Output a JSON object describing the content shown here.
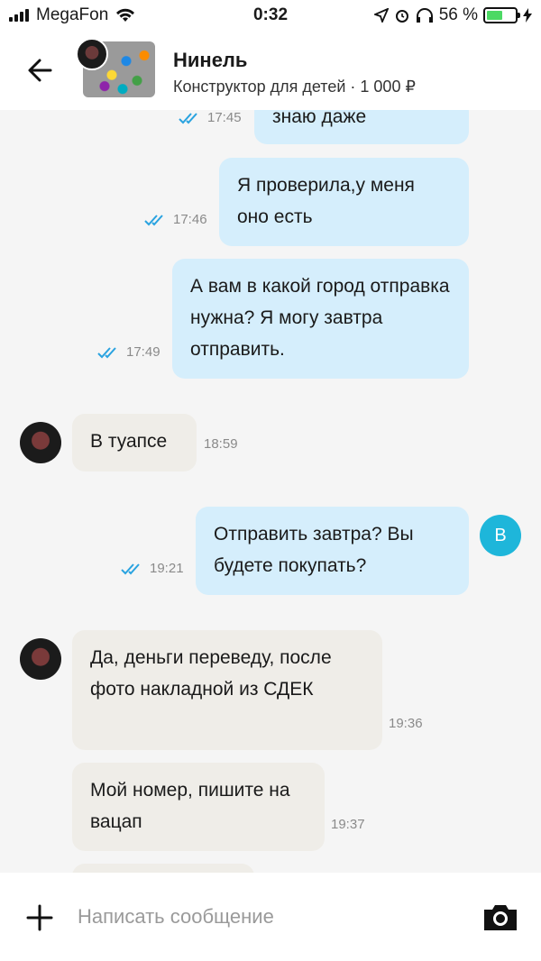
{
  "status_bar": {
    "carrier": "MegaFon",
    "time": "0:32",
    "battery": "56 %",
    "battery_level": 0.56
  },
  "header": {
    "name": "Нинель",
    "subtitle": "Конструктор для детей · 1 000 ₽"
  },
  "messages": [
    {
      "text": "знаю даже",
      "time": "17:45",
      "direction": "out"
    },
    {
      "text": "Я проверила,у меня оно есть",
      "time": "17:46",
      "direction": "out"
    },
    {
      "text": "А вам в какой город отправка нужна? Я могу завтра отправить.",
      "time": "17:49",
      "direction": "out"
    },
    {
      "text": "В туапсе",
      "time": "18:59",
      "direction": "in"
    },
    {
      "text": "Отправить завтра? Вы будете покупать?",
      "time": "19:21",
      "direction": "out"
    },
    {
      "text": "Да, деньги переведу, после фото накладной из СДЕК",
      "time": "19:36",
      "direction": "in"
    },
    {
      "text": "Мой номер, пишите на вацап",
      "time": "19:37",
      "direction": "in"
    }
  ],
  "self_avatar_letter": "В",
  "composer": {
    "placeholder": "Написать сообщение"
  },
  "colors": {
    "outgoing_bubble": "#d5eefc",
    "incoming_bubble": "#efede8",
    "accent": "#1eb6da",
    "ticks": "#2aa3e0"
  }
}
